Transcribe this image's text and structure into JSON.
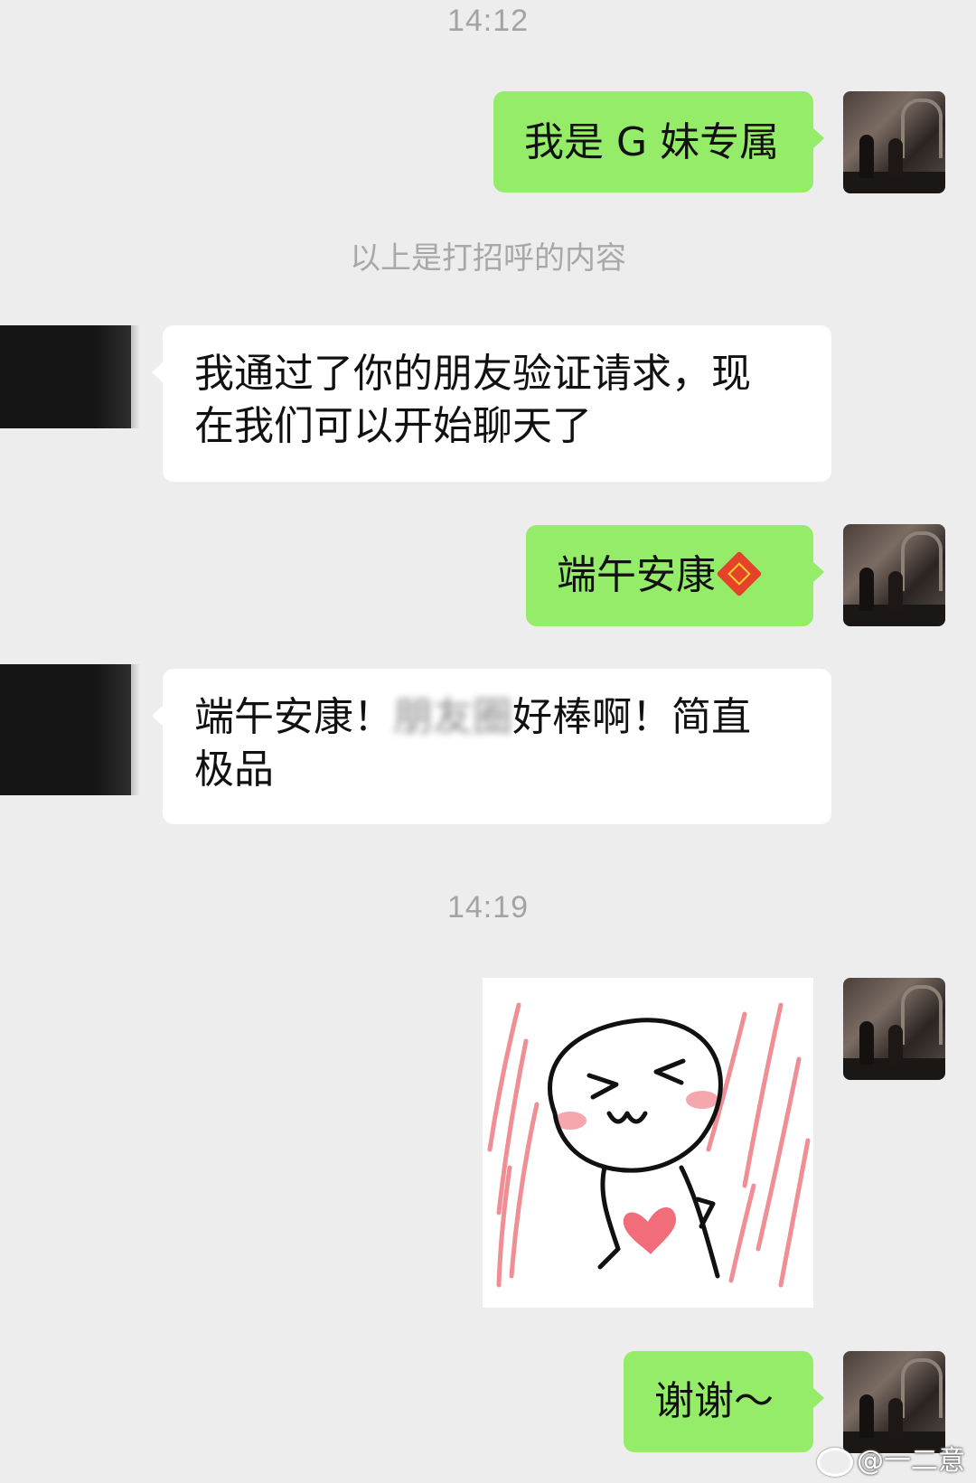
{
  "timestamps": [
    "14:12",
    "14:19"
  ],
  "system_note": "以上是打招呼的内容",
  "messages": [
    {
      "side": "out",
      "text": "我是 G 妹专属"
    },
    {
      "side": "in",
      "line1": "我通过了你的朋友验证请求，现",
      "line2": "在我们可以开始聊天了"
    },
    {
      "side": "out",
      "text": "端午安康",
      "emoji": "fu-icon"
    },
    {
      "side": "in",
      "part_a": "端午安康！",
      "part_blurred": "朋友圈",
      "part_b": "好棒啊！简直",
      "line2": "极品"
    },
    {
      "side": "out",
      "type": "sticker",
      "sticker": "blushing-face-heart-sticker"
    },
    {
      "side": "out",
      "text": "谢谢～"
    }
  ],
  "watermark": {
    "icon": "weibo-icon",
    "text": "@一二意"
  },
  "colors": {
    "background": "#ededed",
    "outgoing_bubble": "#95ec69",
    "incoming_bubble": "#ffffff",
    "timestamp": "#a3a3a3"
  }
}
